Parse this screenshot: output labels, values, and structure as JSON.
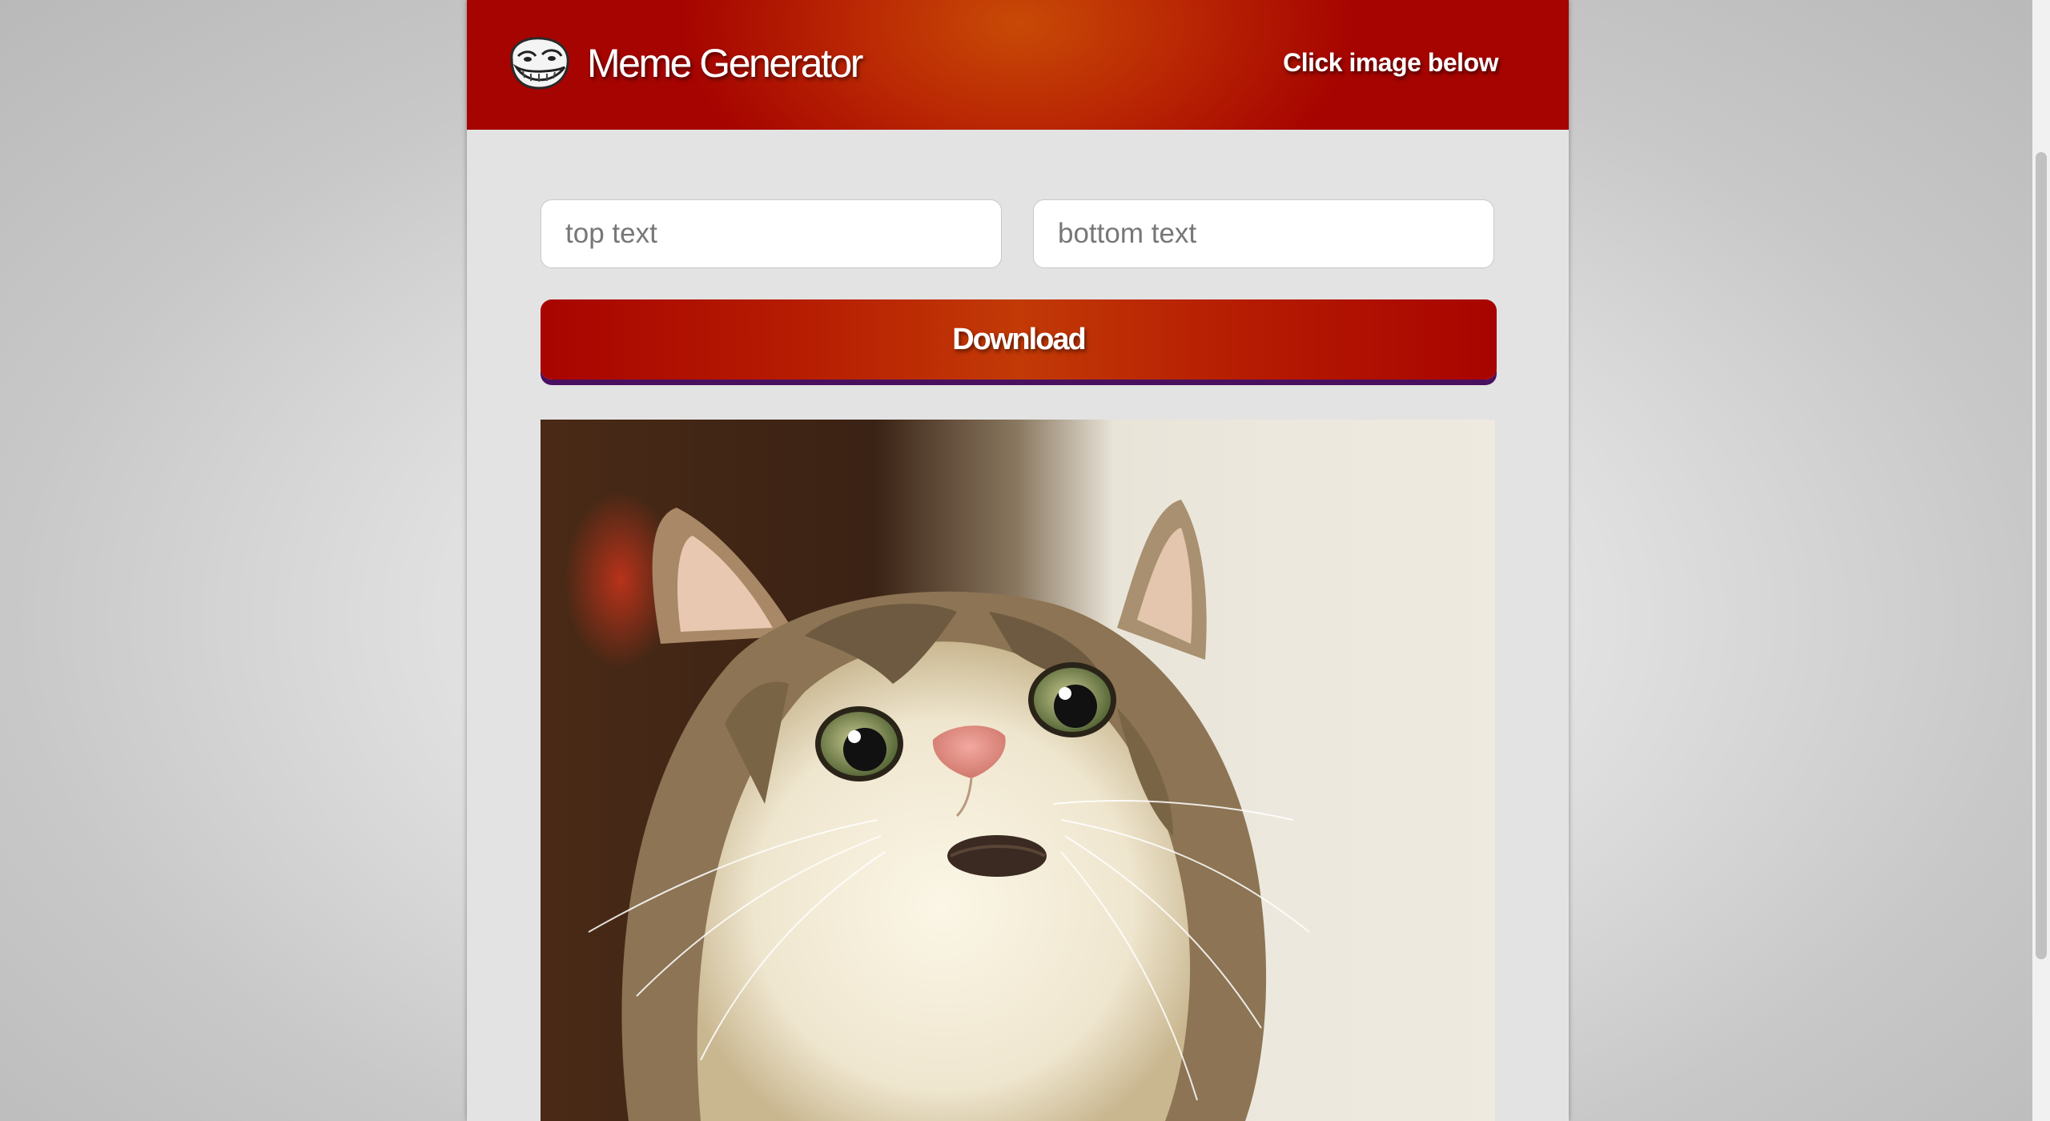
{
  "header": {
    "logo_text": "Meme Generator",
    "logo_icon": "troll-face-icon",
    "hint": "Click image below"
  },
  "form": {
    "top_text": {
      "placeholder": "top text",
      "value": ""
    },
    "bottom_text": {
      "placeholder": "bottom text",
      "value": ""
    },
    "download_label": "Download"
  },
  "image": {
    "subject": "surprised cat",
    "alt": "surprised cat"
  },
  "colors": {
    "header_red": "#a60400",
    "header_orange": "#c84a06",
    "button_shadow": "#4a1060"
  }
}
